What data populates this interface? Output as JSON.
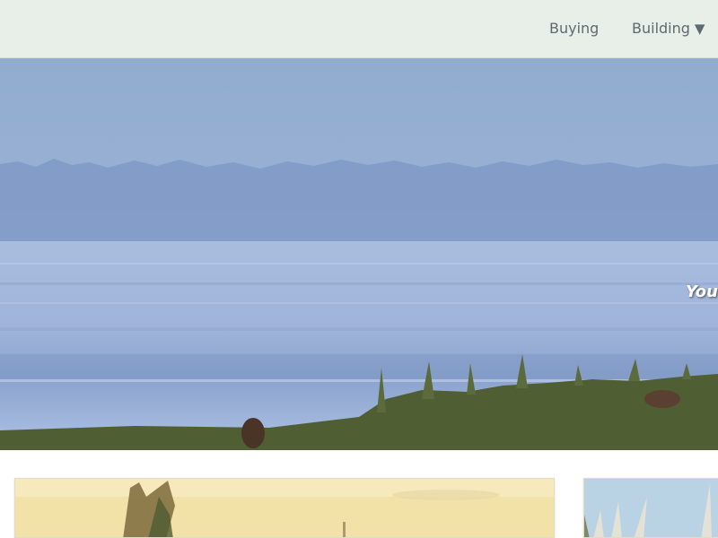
{
  "nav": {
    "items": [
      {
        "label": "Buying"
      },
      {
        "label": "Building",
        "caret": "▼"
      }
    ]
  },
  "hero": {
    "tagline": "You"
  },
  "colors": {
    "topbar_bg": "#e8efe8",
    "nav_text": "#5d6a72",
    "sky": "#97b0d2",
    "water": "#9db3d8",
    "grass": "#4b5a2f"
  },
  "icons": {
    "building_caret": "chevron-down-icon"
  }
}
